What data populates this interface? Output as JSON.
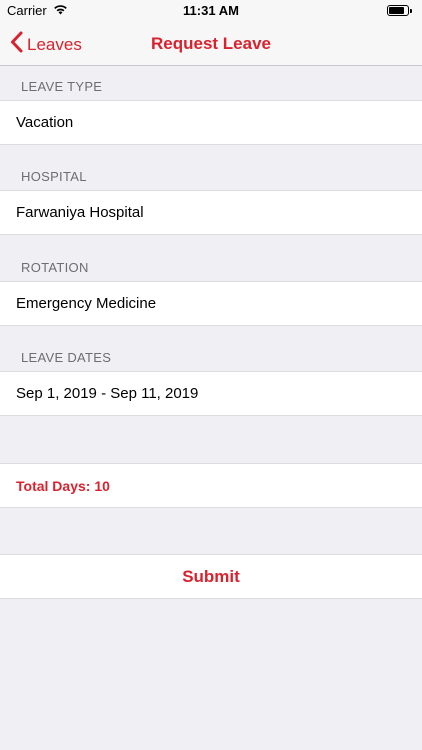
{
  "status_bar": {
    "carrier": "Carrier",
    "time": "11:31 AM",
    "battery_level": 0.85
  },
  "nav": {
    "back_label": "Leaves",
    "title": "Request Leave"
  },
  "form": {
    "leave_type": {
      "header": "LEAVE TYPE",
      "value": "Vacation"
    },
    "hospital": {
      "header": "HOSPITAL",
      "value": "Farwaniya Hospital"
    },
    "rotation": {
      "header": "ROTATION",
      "value": "Emergency Medicine"
    },
    "leave_dates": {
      "header": "LEAVE DATES",
      "value": "Sep 1, 2019 - Sep 11, 2019"
    }
  },
  "total_days": "Total Days: 10",
  "submit_label": "Submit",
  "colors": {
    "accent": "#d8232f",
    "background": "#efeff4",
    "header_text": "#6d6d72"
  },
  "icons": {
    "back": "chevron-left-icon",
    "wifi": "wifi-icon",
    "battery": "battery-icon"
  }
}
